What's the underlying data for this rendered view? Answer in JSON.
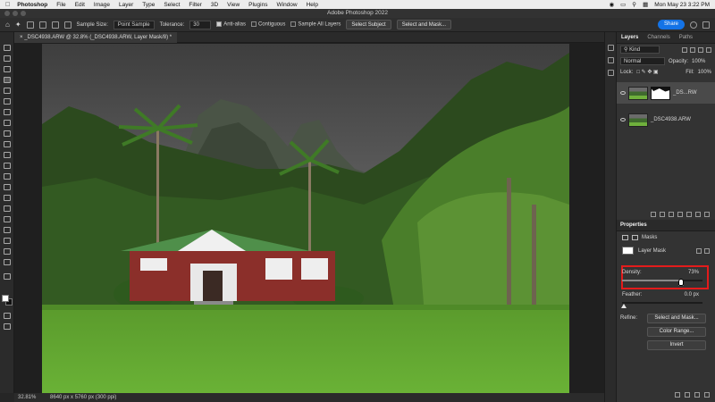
{
  "menubar": {
    "app_name": "Photoshop",
    "items": [
      "File",
      "Edit",
      "Image",
      "Layer",
      "Type",
      "Select",
      "Filter",
      "3D",
      "View",
      "Plugins",
      "Window",
      "Help"
    ],
    "clock": "Mon May 23  3:22 PM"
  },
  "titlebar": {
    "title": "Adobe Photoshop 2022"
  },
  "options": {
    "sample_size_label": "Sample Size:",
    "sample_size_value": "Point Sample",
    "tolerance_label": "Tolerance:",
    "tolerance_value": "30",
    "anti_alias_label": "Anti-alias",
    "contiguous_label": "Contiguous",
    "sample_all_label": "Sample All Layers",
    "select_subject_label": "Select Subject",
    "select_mask_label": "Select and Mask...",
    "share_label": "Share"
  },
  "document": {
    "tab_title": "_DSC4938.ARW @ 32.8% (_DSC4938.ARW, Layer Mask/8) *"
  },
  "status": {
    "zoom": "32.81%",
    "dimensions": "8640 px x 5760 px (300 ppi)"
  },
  "layers_panel": {
    "tabs": [
      "Layers",
      "Channels",
      "Paths"
    ],
    "kind_label": "Kind",
    "blend_mode": "Normal",
    "opacity_label": "Opacity:",
    "opacity_value": "100%",
    "lock_label": "Lock:",
    "fill_label": "Fill:",
    "fill_value": "100%",
    "layers": [
      {
        "name": "_DS...RW",
        "selected": true
      },
      {
        "name": "_DSC4938.ARW",
        "selected": false
      }
    ]
  },
  "properties_panel": {
    "title": "Properties",
    "masks_label": "Masks",
    "layer_mask_label": "Layer Mask",
    "density_label": "Density:",
    "density_value": "73%",
    "density_fraction": 0.73,
    "feather_label": "Feather:",
    "feather_value": "0.0 px",
    "feather_fraction": 0.0,
    "refine_label": "Refine:",
    "select_mask_button": "Select and Mask...",
    "color_range_button": "Color Range...",
    "invert_button": "Invert"
  }
}
